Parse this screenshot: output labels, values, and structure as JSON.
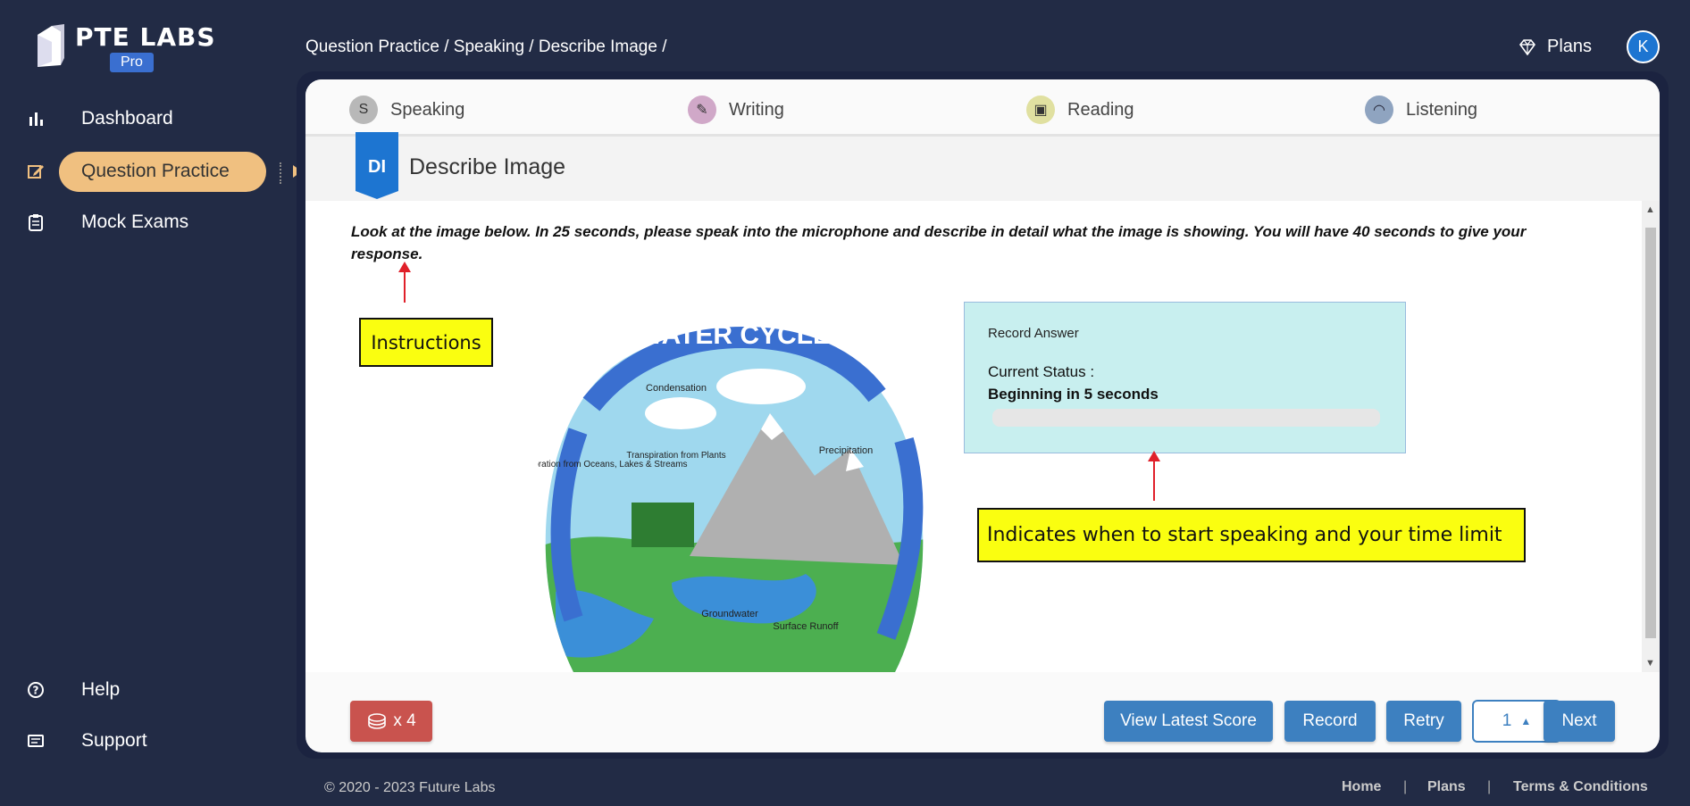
{
  "brand": {
    "name": "PTE LABS",
    "badge": "Pro"
  },
  "nav": {
    "items": [
      {
        "label": "Dashboard"
      },
      {
        "label": "Question Practice"
      },
      {
        "label": "Mock Exams"
      }
    ],
    "bottom": [
      {
        "label": "Help"
      },
      {
        "label": "Support"
      }
    ]
  },
  "breadcrumb": "Question Practice / Speaking / Describe Image /",
  "header": {
    "plans_label": "Plans",
    "avatar_letter": "K"
  },
  "tabs": [
    {
      "label": "Speaking",
      "icon": "speaking-icon",
      "color": "#b8b8b8"
    },
    {
      "label": "Writing",
      "icon": "writing-icon",
      "color": "#d0a8c8"
    },
    {
      "label": "Reading",
      "icon": "reading-icon",
      "color": "#e0e0a0"
    },
    {
      "label": "Listening",
      "icon": "headphones-icon",
      "color": "#8fa4c0"
    }
  ],
  "question": {
    "badge": "DI",
    "title": "Describe Image",
    "instructions": "Look at the image below. In 25 seconds, please speak into the microphone and describe in detail what the image is showing. You will have 40 seconds to give your response."
  },
  "image": {
    "title": "WATER CYCLE",
    "labels": {
      "condensation": "Condensation",
      "transpiration": "Transpiration from Plants",
      "evaporation": "Evaporation from Oceans, Lakes & Streams",
      "precipitation": "Precipitation",
      "groundwater": "Groundwater",
      "runoff": "Surface Runoff"
    }
  },
  "annotations": {
    "instructions": "Instructions",
    "timer": "Indicates when to start speaking and your time limit"
  },
  "recorder": {
    "title": "Record Answer",
    "status_label": "Current Status :",
    "status": "Beginning in 5 seconds",
    "progress": 0
  },
  "footer_buttons": {
    "coins": "x 4",
    "view_score": "View Latest Score",
    "record": "Record",
    "retry": "Retry",
    "page": "1",
    "next": "Next"
  },
  "footer": {
    "copyright": "© 2020 - 2023 Future Labs",
    "links": [
      "Home",
      "Plans",
      "Terms & Conditions"
    ]
  }
}
